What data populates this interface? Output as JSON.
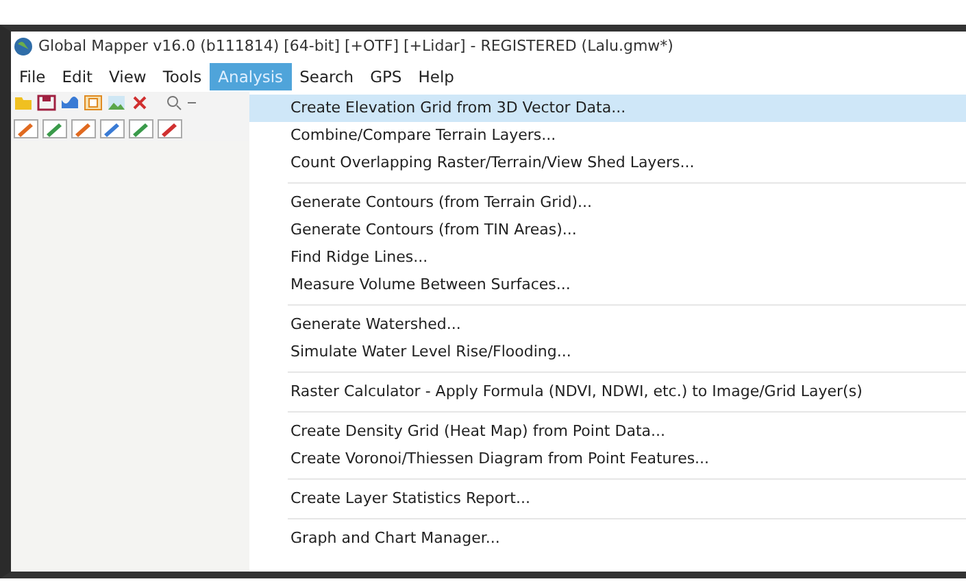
{
  "window": {
    "title": "Global Mapper v16.0 (b111814) [64-bit] [+OTF] [+Lidar] - REGISTERED (Lalu.gmw*)"
  },
  "menu_bar": [
    {
      "label": "File",
      "selected": false
    },
    {
      "label": "Edit",
      "selected": false
    },
    {
      "label": "View",
      "selected": false
    },
    {
      "label": "Tools",
      "selected": false
    },
    {
      "label": "Analysis",
      "selected": true
    },
    {
      "label": "Search",
      "selected": false
    },
    {
      "label": "GPS",
      "selected": false
    },
    {
      "label": "Help",
      "selected": false
    }
  ],
  "menu": {
    "groups": [
      [
        {
          "label": "Create Elevation Grid from 3D Vector Data...",
          "selected": true
        },
        {
          "label": "Combine/Compare Terrain Layers...",
          "selected": false
        },
        {
          "label": "Count Overlapping Raster/Terrain/View Shed Layers...",
          "selected": false
        }
      ],
      [
        {
          "label": "Generate Contours (from Terrain Grid)...",
          "selected": false
        },
        {
          "label": "Generate Contours (from TIN Areas)...",
          "selected": false
        },
        {
          "label": "Find Ridge Lines...",
          "selected": false
        },
        {
          "label": "Measure Volume Between Surfaces...",
          "selected": false
        }
      ],
      [
        {
          "label": "Generate Watershed...",
          "selected": false
        },
        {
          "label": "Simulate Water Level Rise/Flooding...",
          "selected": false
        }
      ],
      [
        {
          "label": "Raster Calculator - Apply Formula (NDVI, NDWI, etc.) to Image/Grid Layer(s)",
          "selected": false
        }
      ],
      [
        {
          "label": "Create Density Grid (Heat Map) from Point Data...",
          "selected": false
        },
        {
          "label": "Create Voronoi/Thiessen Diagram from Point Features...",
          "selected": false
        }
      ],
      [
        {
          "label": "Create Layer Statistics Report...",
          "selected": false
        }
      ],
      [
        {
          "label": "Graph and Chart Manager...",
          "selected": false
        }
      ]
    ]
  }
}
